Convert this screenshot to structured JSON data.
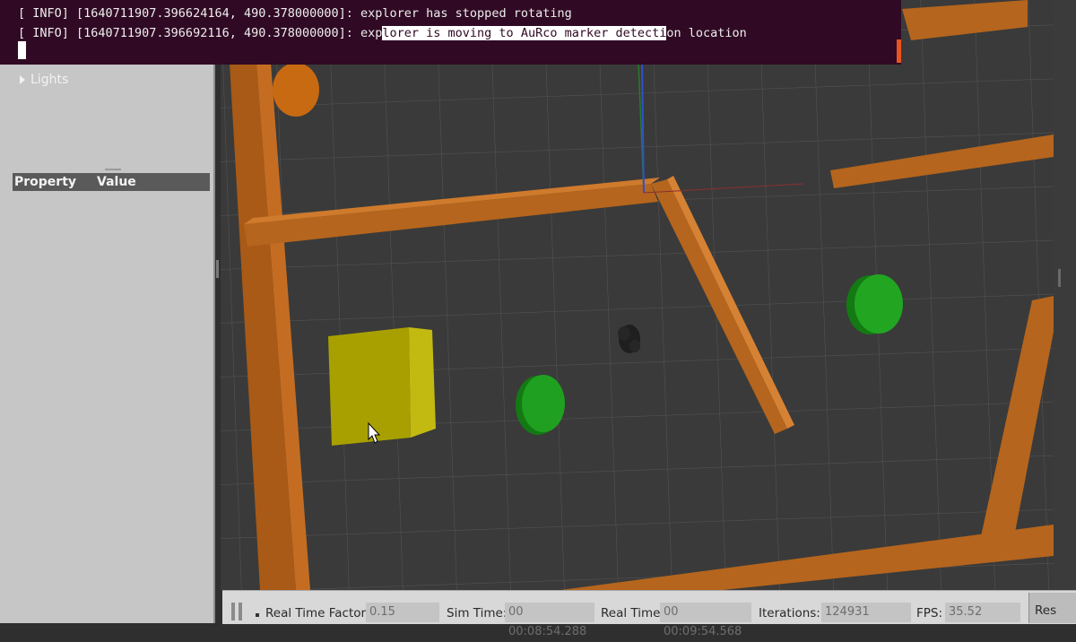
{
  "terminal": {
    "line1_prefix": "[ INFO] [1640711907.396624164, 490.378000000]: ",
    "line1_msg": "explorer has stopped rotating",
    "line2_prefix": "[ INFO] [1640711907.396692116, 490.378000000]: exp",
    "line2_highlight": "lorer is moving to AuRco marker detecti",
    "line2_suffix": "on location"
  },
  "world_tree": {
    "items": [
      {
        "label": "Lights",
        "icon": "chevron-right-icon"
      }
    ]
  },
  "property_panel": {
    "col_property": "Property",
    "col_value": "Value"
  },
  "toolbar": {
    "real_time_factor_label": "Real Time Factor:",
    "real_time_factor_value": "0.15",
    "sim_time_label": "Sim Time:",
    "sim_time_value": "00 00:08:54.288",
    "real_time_label": "Real Time:",
    "real_time_value": "00 00:09:54.568",
    "iterations_label": "Iterations:",
    "iterations_value": "124931",
    "fps_label": "FPS:",
    "fps_value": "35.52",
    "reset_label": "Res"
  },
  "icons": [
    "pause-icon",
    "chevron-right-icon",
    "mouse-cursor-icon"
  ],
  "colors": {
    "terminal_bg": "#300a24",
    "wall": "#b5651d",
    "box": "#b7b000",
    "marker": "#1a8f1a",
    "grid": "#555555"
  }
}
